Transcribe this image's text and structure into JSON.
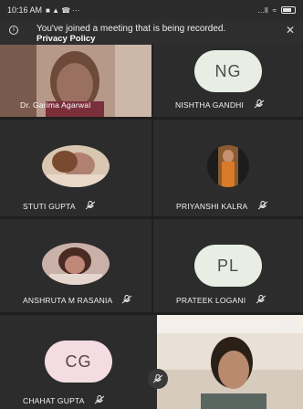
{
  "status_bar": {
    "time": "10:16 AM",
    "glyphs": "■ ▲ ☎ ···",
    "signal": "…ll",
    "wifi": "≈"
  },
  "banner": {
    "message": "You've joined a meeting that is being recorded.",
    "link": "Privacy Policy",
    "close": "✕",
    "info": "i"
  },
  "participants": [
    {
      "name": "Dr. Garima Agarwal",
      "tile": "video"
    },
    {
      "name": "NISHTHA GANDHI",
      "initials": "NG",
      "tile": "initials",
      "muted": true
    },
    {
      "name": "STUTI GUPTA",
      "tile": "photo",
      "muted": true
    },
    {
      "name": "PRIYANSHI KALRA",
      "tile": "photo",
      "muted": true
    },
    {
      "name": "ANSHRUTA M RASANIA",
      "tile": "photo",
      "muted": true
    },
    {
      "name": "PRATEEK LOGANI",
      "initials": "PL",
      "tile": "initials",
      "muted": true
    },
    {
      "name": "CHAHAT GUPTA",
      "initials": "CG",
      "tile": "initials",
      "muted": true
    },
    {
      "name": "",
      "tile": "video"
    }
  ],
  "colors": {
    "tile_bg": "#2c2c2c",
    "initials_bg": "#e8eee3",
    "initials_text": "#4b4f4a",
    "initials_bg_pink": "#f3dde2",
    "initials_text_pink": "#5a4246"
  }
}
